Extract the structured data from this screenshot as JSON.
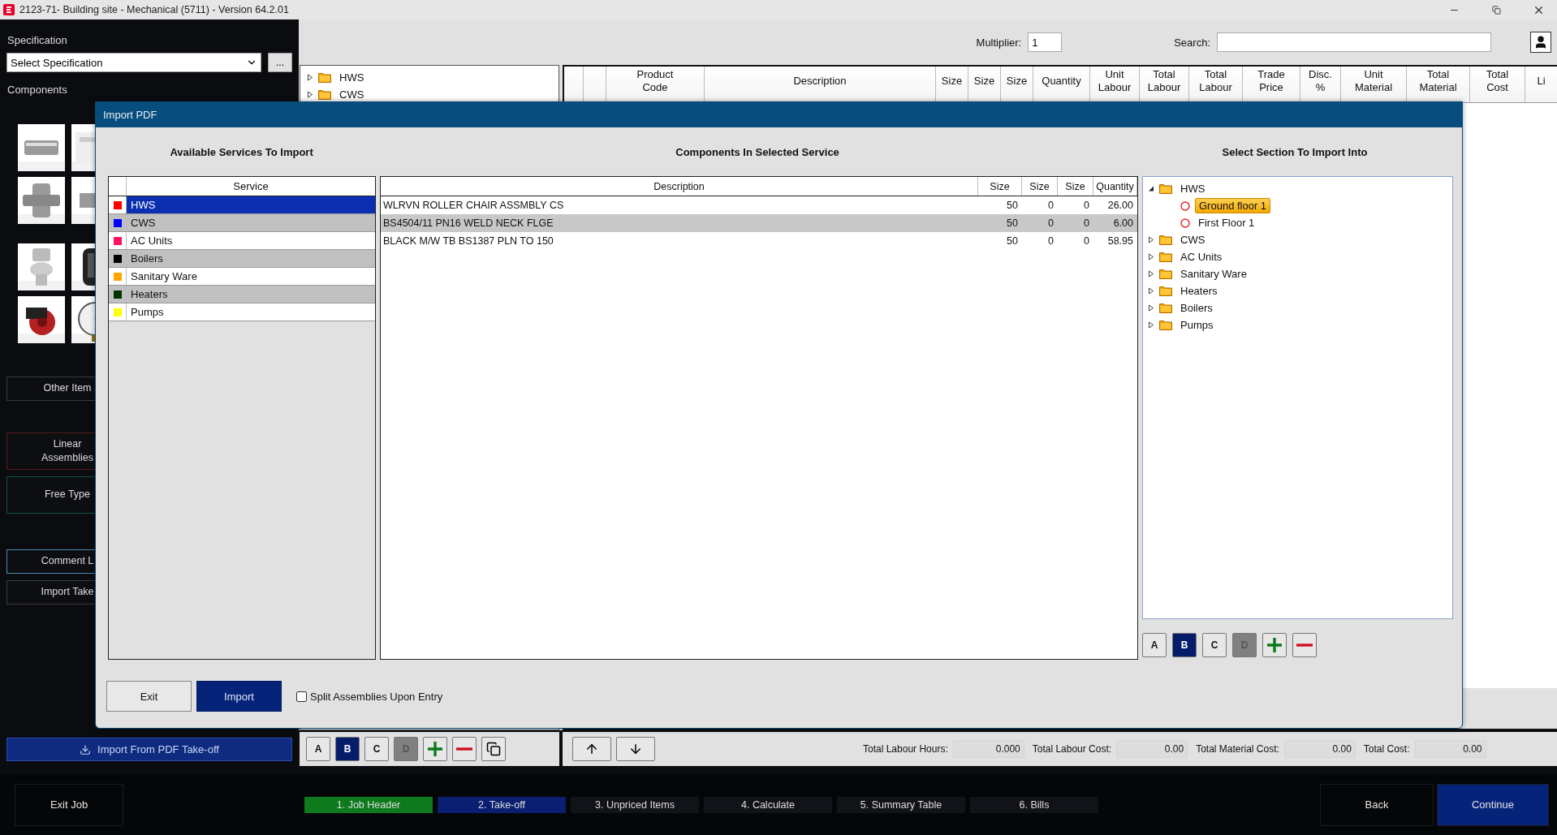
{
  "window": {
    "title": "2123-71- Building site - Mechanical (5711) - Version 64.2.01"
  },
  "sidebar": {
    "specification_label": "Specification",
    "specification_select": "Select Specification",
    "more_button": "...",
    "components_label": "Components",
    "buttons": [
      {
        "label": "Other Item",
        "color": "#3a3a44"
      },
      {
        "label": "Linear\nAssemblies",
        "color": "#5a1a1a"
      },
      {
        "label": "Free Type",
        "color": "#12504c"
      },
      {
        "label": "Comment L",
        "color": "#4a8ab0"
      },
      {
        "label": "Import Take",
        "color": "#3a3a44"
      }
    ],
    "import_pdf_button": "Import From PDF Take-off"
  },
  "toolbar": {
    "multiplier_label": "Multiplier:",
    "multiplier_value": "1",
    "search_label": "Search:"
  },
  "section_tree": [
    {
      "label": "HWS",
      "expanded": false
    },
    {
      "label": "CWS",
      "expanded": false
    }
  ],
  "table": {
    "columns": [
      "Product\nCode",
      "Description",
      "Size",
      "Size",
      "Size",
      "Quantity",
      "Unit\nLabour",
      "Total\nLabour",
      "Total\nLabour",
      "Trade\nPrice",
      "Disc.\n%",
      "Unit\nMaterial",
      "Total\nMaterial",
      "Total\nCost",
      "Li"
    ]
  },
  "bottom_toolbar": {
    "letters": [
      {
        "label": "A",
        "selected": false,
        "disabled": false
      },
      {
        "label": "B",
        "selected": true,
        "disabled": false
      },
      {
        "label": "C",
        "selected": false,
        "disabled": false
      },
      {
        "label": "D",
        "selected": false,
        "disabled": true
      }
    ],
    "totals": [
      {
        "label": "Total Labour Hours:",
        "value": "0.000"
      },
      {
        "label": "Total Labour Cost:",
        "value": "0.00"
      },
      {
        "label": "Total Material Cost:",
        "value": "0.00"
      },
      {
        "label": "Total Cost:",
        "value": "0.00"
      }
    ]
  },
  "nav": {
    "exit_job": "Exit Job",
    "steps": [
      {
        "label": "1. Job Header",
        "selected": false,
        "completed": true
      },
      {
        "label": "2. Take-off",
        "selected": true,
        "completed": false
      },
      {
        "label": "3. Unpriced Items",
        "selected": false,
        "completed": false
      },
      {
        "label": "4. Calculate",
        "selected": false,
        "completed": false
      },
      {
        "label": "5. Summary Table",
        "selected": false,
        "completed": false
      },
      {
        "label": "6. Bills",
        "selected": false,
        "completed": false
      }
    ],
    "back": "Back",
    "continue": "Continue"
  },
  "dialog": {
    "title": "Import PDF",
    "services_heading": "Available Services To Import",
    "components_heading": "Components In Selected Service",
    "sections_heading": "Select Section To Import Into",
    "services_column": "Service",
    "services": [
      {
        "name": "HWS",
        "color": "#ff0000",
        "selected": true
      },
      {
        "name": "CWS",
        "color": "#0000ff",
        "selected": false
      },
      {
        "name": "AC Units",
        "color": "#ff1060",
        "selected": false
      },
      {
        "name": "Boilers",
        "color": "#000000",
        "selected": false
      },
      {
        "name": "Sanitary Ware",
        "color": "#ffa500",
        "selected": false
      },
      {
        "name": "Heaters",
        "color": "#003300",
        "selected": false
      },
      {
        "name": "Pumps",
        "color": "#ffff00",
        "selected": false
      }
    ],
    "component_columns": [
      "Description",
      "Size",
      "Size",
      "Size",
      "Quantity"
    ],
    "components": [
      [
        "WLRVN ROLLER CHAIR ASSMBLY CS",
        "50",
        "0",
        "0",
        "26.00"
      ],
      [
        "BS4504/11 PN16  WELD NECK FLGE",
        "50",
        "0",
        "0",
        "6.00"
      ],
      [
        "BLACK M/W TB BS1387 PLN TO 150",
        "50",
        "0",
        "0",
        "58.95"
      ]
    ],
    "tree": [
      {
        "label": "HWS",
        "expanded": true,
        "selected": false,
        "children": [
          {
            "label": "Ground floor 1",
            "selected": true
          },
          {
            "label": "First Floor 1",
            "selected": false
          }
        ]
      },
      {
        "label": "CWS",
        "expanded": false,
        "selected": false
      },
      {
        "label": "AC Units",
        "expanded": false,
        "selected": false
      },
      {
        "label": "Sanitary Ware",
        "expanded": false,
        "selected": false
      },
      {
        "label": "Heaters",
        "expanded": false,
        "selected": false
      },
      {
        "label": "Boilers",
        "expanded": false,
        "selected": false
      },
      {
        "label": "Pumps",
        "expanded": false,
        "selected": false
      }
    ],
    "letters": [
      {
        "label": "A",
        "selected": false,
        "disabled": false
      },
      {
        "label": "B",
        "selected": true,
        "disabled": false
      },
      {
        "label": "C",
        "selected": false,
        "disabled": false
      },
      {
        "label": "D",
        "selected": false,
        "disabled": true
      }
    ],
    "exit_button": "Exit",
    "import_button": "Import",
    "split_checkbox": {
      "label": "Split Assemblies Upon Entry",
      "checked": false
    }
  }
}
